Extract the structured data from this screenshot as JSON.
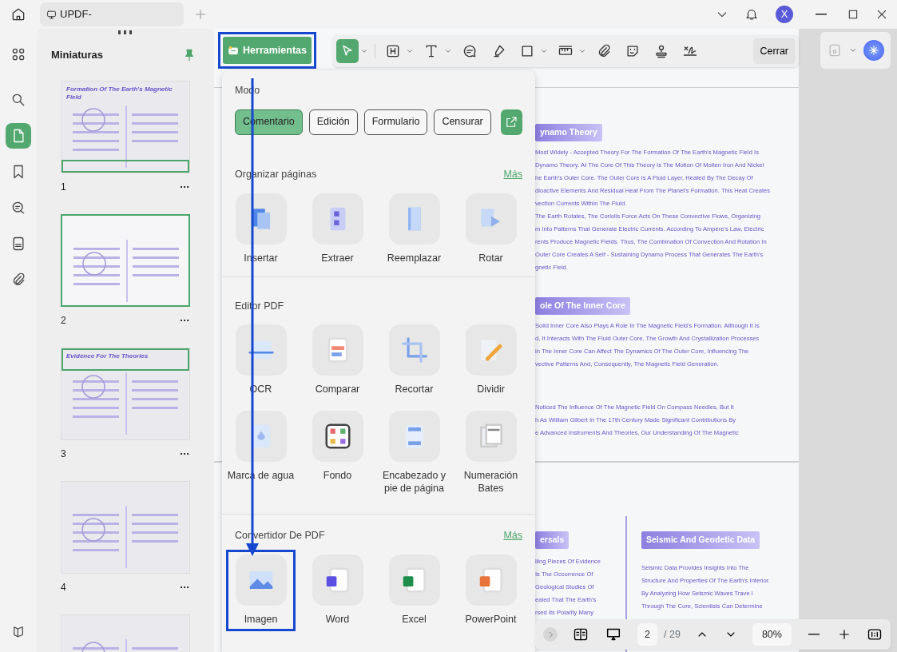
{
  "top_bar": {
    "tab_title": "UPDF-",
    "avatar": "X"
  },
  "rail": {
    "items": [
      {
        "kind": "apps",
        "selected": false
      },
      {
        "kind": "search",
        "selected": false
      },
      {
        "kind": "pages",
        "selected": true
      },
      {
        "kind": "bookmark",
        "selected": false
      },
      {
        "kind": "comments",
        "selected": false
      },
      {
        "kind": "form",
        "selected": false
      },
      {
        "kind": "attachment",
        "selected": false
      }
    ]
  },
  "thumbnails": {
    "title": "Miniaturas",
    "pages": [
      {
        "number": "1",
        "selected": false,
        "viewport": true,
        "viewport_top": false,
        "title": "Formation Of The Earth's Magnetic Field"
      },
      {
        "number": "2",
        "selected": true
      },
      {
        "number": "3",
        "selected": false,
        "viewport": true,
        "viewport_top": true,
        "title": "Evidence For The Theories"
      },
      {
        "number": "4",
        "selected": false
      },
      {
        "selected": false
      }
    ]
  },
  "toolbar": {
    "tools_button": "Herramientas",
    "tools_highlighted": true,
    "tools": [
      {
        "kind": "select",
        "selected": true,
        "dropdown": true
      },
      {
        "kind": "heading",
        "selected": false,
        "dropdown": true
      },
      {
        "kind": "text",
        "selected": false,
        "dropdown": true
      },
      {
        "kind": "comment",
        "selected": false
      },
      {
        "kind": "highlighter",
        "selected": false
      },
      {
        "kind": "rectangle",
        "selected": false,
        "dropdown": true
      },
      {
        "kind": "measure",
        "selected": false,
        "dropdown": true
      },
      {
        "kind": "attach",
        "selected": false
      },
      {
        "kind": "sticker",
        "selected": false
      },
      {
        "kind": "stamp",
        "selected": false
      },
      {
        "kind": "signature",
        "selected": false
      }
    ],
    "close": "Cerrar"
  },
  "tools_panel": {
    "mode_label": "Modo",
    "modes": [
      {
        "label": "Comentario",
        "selected": true
      },
      {
        "label": "Edición",
        "selected": false
      },
      {
        "label": "Formulario",
        "selected": false
      },
      {
        "label": "Censurar",
        "selected": false
      }
    ],
    "sections": [
      {
        "title": "Organizar páginas",
        "more": "Más",
        "items": [
          {
            "label": "Insertar",
            "kind": "insert",
            "highlighted": false
          },
          {
            "label": "Extraer",
            "kind": "extract",
            "highlighted": false
          },
          {
            "label": "Reemplazar",
            "kind": "replace",
            "highlighted": false
          },
          {
            "label": "Rotar",
            "kind": "rotate",
            "highlighted": false
          }
        ]
      },
      {
        "title": "Editor PDF",
        "items": [
          {
            "label": "OCR",
            "kind": "ocr",
            "highlighted": false
          },
          {
            "label": "Comparar",
            "kind": "compare",
            "highlighted": false
          },
          {
            "label": "Recortar",
            "kind": "crop",
            "highlighted": false
          },
          {
            "label": "Dividir",
            "kind": "split",
            "highlighted": false
          },
          {
            "label": "Marca de agua",
            "kind": "watermark",
            "highlighted": false
          },
          {
            "label": "Fondo",
            "kind": "background",
            "highlighted": false
          },
          {
            "label": "Encabezado y pie de página",
            "kind": "header",
            "highlighted": false
          },
          {
            "label": "Numeración Bates",
            "kind": "bates",
            "highlighted": false
          }
        ]
      },
      {
        "title": "Convertidor De PDF",
        "more": "Más",
        "items": [
          {
            "label": "Imagen",
            "kind": "image",
            "highlighted": true
          },
          {
            "label": "Word",
            "kind": "word",
            "highlighted": false
          },
          {
            "label": "Excel",
            "kind": "excel",
            "highlighted": false
          },
          {
            "label": "PowerPoint",
            "kind": "powerpoint",
            "highlighted": false
          }
        ]
      }
    ]
  },
  "document": {
    "page1": [
      {
        "heading": "ynamo Theory",
        "lines": [
          "Most Widely - Accepted Theory For The Formation Of The Earth's Magnetic Field Is",
          "Dynamo Theory. At The Core Of This Theory Is The Motion Of Molten Iron And Nickel",
          "he Earth's Outer Core. The Outer Core Is A Fluid Layer, Heated By The Decay Of",
          "dioactive Elements And Residual Heat From The Planet's Formation. This Heat Creates",
          "vection Currents Within The Fluid.",
          "The Earth Rotates, The Coriolis Force Acts On These Convective Flows, Organizing",
          "m Into Patterns That Generate Electric Currents. According To Ampere's Law, Electric",
          "rents Produce Magnetic Fields. Thus, The Combination Of Convection And Rotation In",
          "Outer Core Creates A Self - Sustaining Dynamo Process That Generates The Earth's",
          "gnetic Field."
        ]
      },
      {
        "heading": "ole Of The Inner Core",
        "lines": [
          "Solid Inner Core Also Plays A Role In The Magnetic Field's Formation. Although It Is",
          "d, It Interacts With The Fluid Outer Core. The Growth And Crystallization Processes",
          "in The Inner Core Can Affect The Dynamics Of The Outer Core, Influencing The",
          "vective Patterns And, Consequently, The Magnetic Field Generation."
        ]
      },
      {
        "lines": [
          "Noticed The Influence Of The Magnetic Field On Compass Needles, But It",
          "h As William Gilbert In The 17th Century Made Significant Contributions By",
          "e Advanced Instruments And Theories, Our Understanding Of The Magnetic"
        ]
      }
    ],
    "page2": [
      {
        "heading": "ersals",
        "lines": [
          "lling Pieces Of Evidence",
          "Is The Occurrence Of",
          "Geological Studies Of",
          "ealed That The Earth's",
          "rsed Its Polarity Many"
        ]
      },
      {
        "heading": "Seismic And Geodetic Data",
        "lines": [
          "Seismic Data Provides Insights Into The",
          "Structure And Properties Of The Earth's Interior.",
          "By Analyzing How Seismic Waves Trave l",
          "Through The Core, Scientists Can Determine"
        ]
      }
    ]
  },
  "bottom_bar": {
    "page": "2",
    "total": "/ 29",
    "zoom": "80%"
  }
}
